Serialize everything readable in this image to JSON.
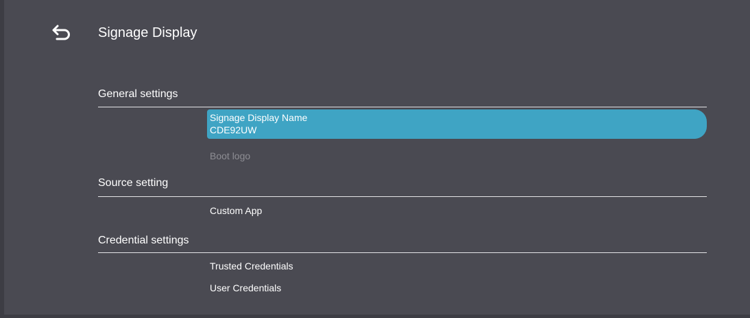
{
  "header": {
    "back_icon": "back-arrow-icon",
    "title": "Signage Display"
  },
  "sections": [
    {
      "label": "General settings",
      "items": [
        {
          "label": "Signage Display Name",
          "value": "CDE92UW",
          "selected": true
        },
        {
          "label": "Boot logo",
          "disabled": true
        }
      ]
    },
    {
      "label": "Source setting",
      "items": [
        {
          "label": "Custom App"
        }
      ]
    },
    {
      "label": "Credential settings",
      "items": [
        {
          "label": "Trusted Credentials"
        },
        {
          "label": "User Credentials"
        }
      ]
    }
  ],
  "colors": {
    "background": "#4a4a52",
    "highlight": "#3fa4c4",
    "text": "#ffffff",
    "disabled_text": "#8e8e94"
  }
}
